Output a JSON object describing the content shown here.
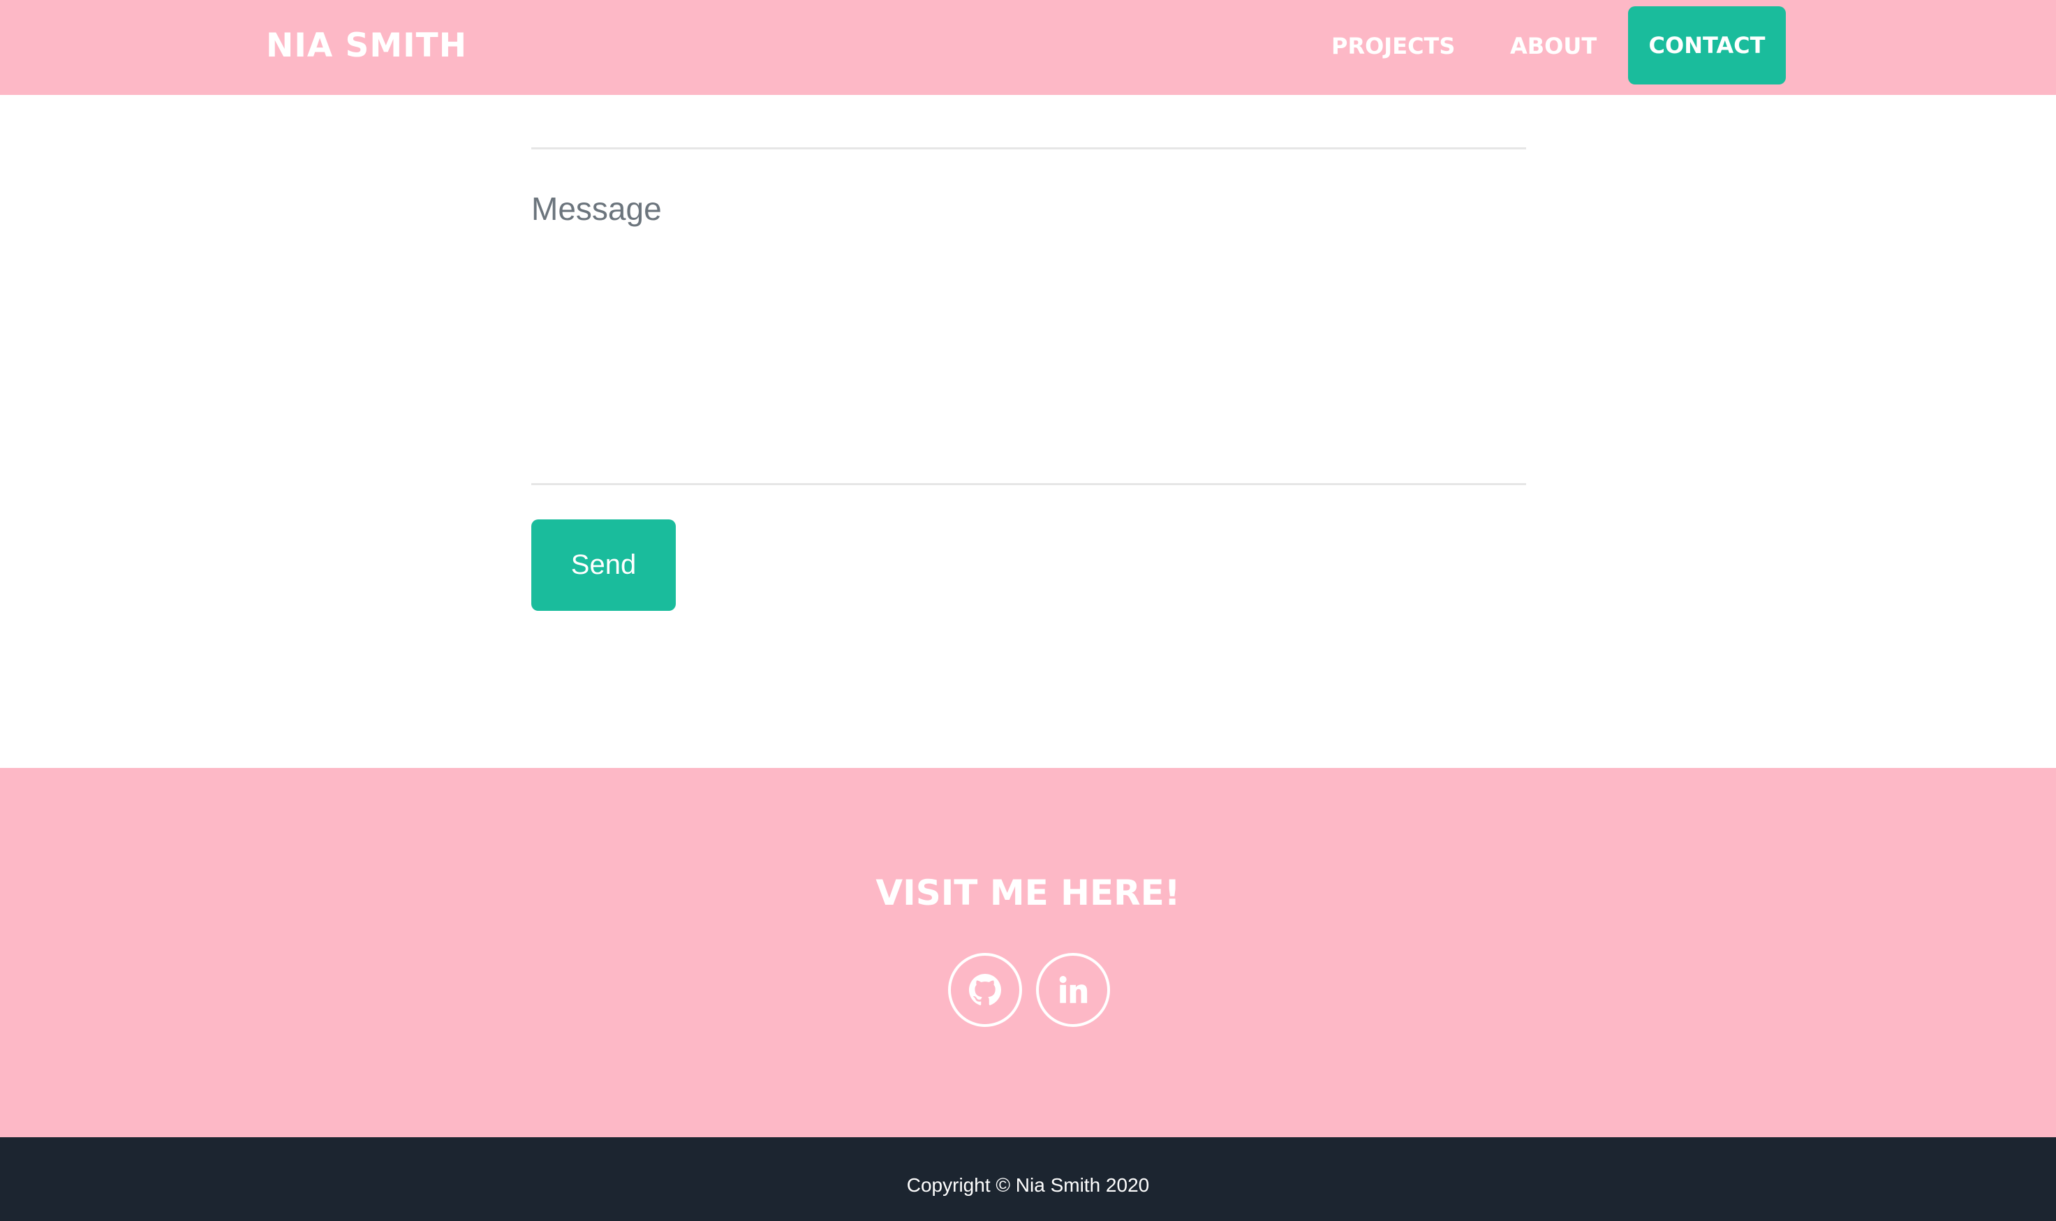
{
  "navbar": {
    "brand": "NIA SMITH",
    "links": [
      {
        "label": "PROJECTS"
      },
      {
        "label": "ABOUT"
      },
      {
        "label": "CONTACT",
        "active": true
      }
    ]
  },
  "contact_form": {
    "message": {
      "placeholder": "Message",
      "value": ""
    },
    "send_label": "Send"
  },
  "footer": {
    "title": "VISIT ME HERE!",
    "social": [
      {
        "icon": "github-icon"
      },
      {
        "icon": "linkedin-icon"
      }
    ],
    "copyright": "Copyright © Nia Smith 2020"
  },
  "colors": {
    "pink": "#fdb8c6",
    "accent": "#1abc9c",
    "dark": "#1c2530",
    "white": "#ffffff"
  }
}
